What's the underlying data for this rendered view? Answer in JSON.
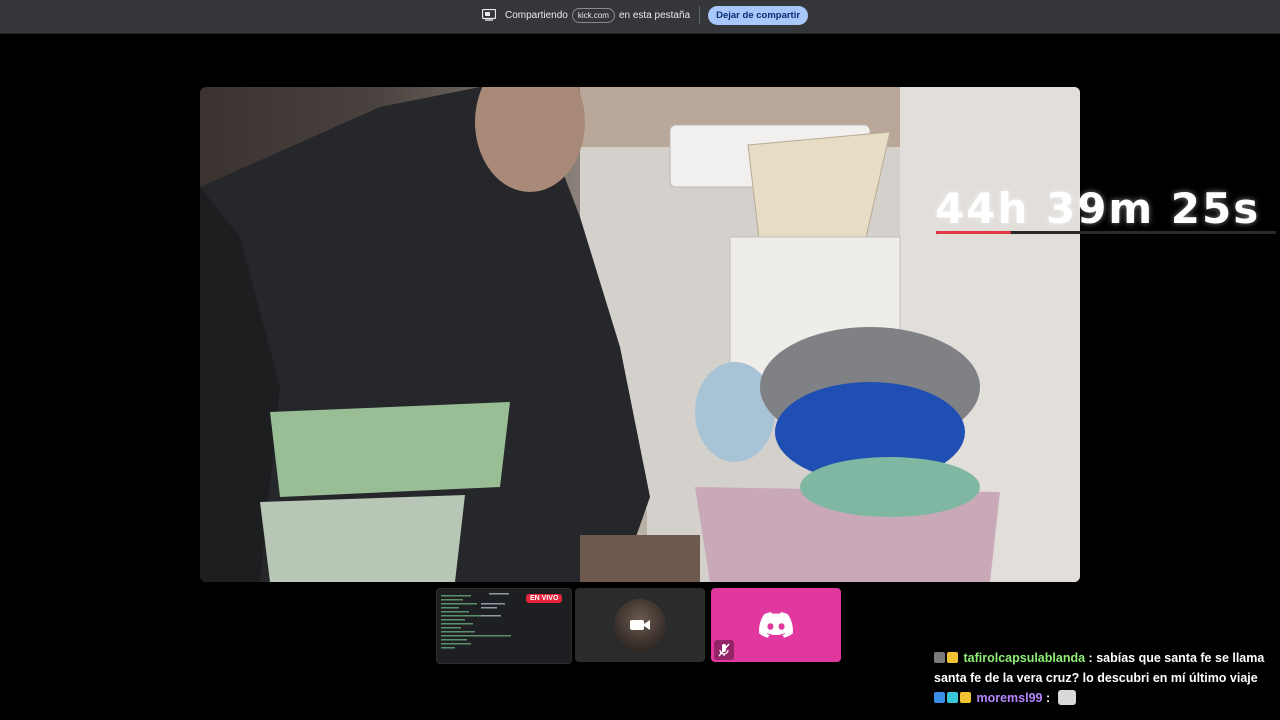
{
  "share_bar": {
    "text_before": "Compartiendo",
    "domain": "kick.com",
    "text_after": "en esta pestaña",
    "stop_label": "Dejar de compartir"
  },
  "stream": {
    "timer_text": "44h 39m 25s",
    "timer_progress": 0.22
  },
  "thumbnails": [
    {
      "kind": "screen-share",
      "live_label": "EN VIVO"
    },
    {
      "kind": "camera"
    },
    {
      "kind": "discord"
    }
  ],
  "chat": {
    "messages": [
      {
        "user": "tafirolcapsulablanda",
        "separator": ":",
        "text": "sabías que santa fe se llama santa fe de la vera cruz? lo descubri en mí último viaje",
        "user_color": "#8ef077"
      },
      {
        "user": "moremsl99",
        "separator": ":",
        "text": "",
        "user_color": "#b784ff"
      }
    ]
  },
  "colors": {
    "live_badge": "#e5233d",
    "discord": "#e0389f",
    "stop_button": "#a8c7fa",
    "timer_bar": "#e53945"
  }
}
